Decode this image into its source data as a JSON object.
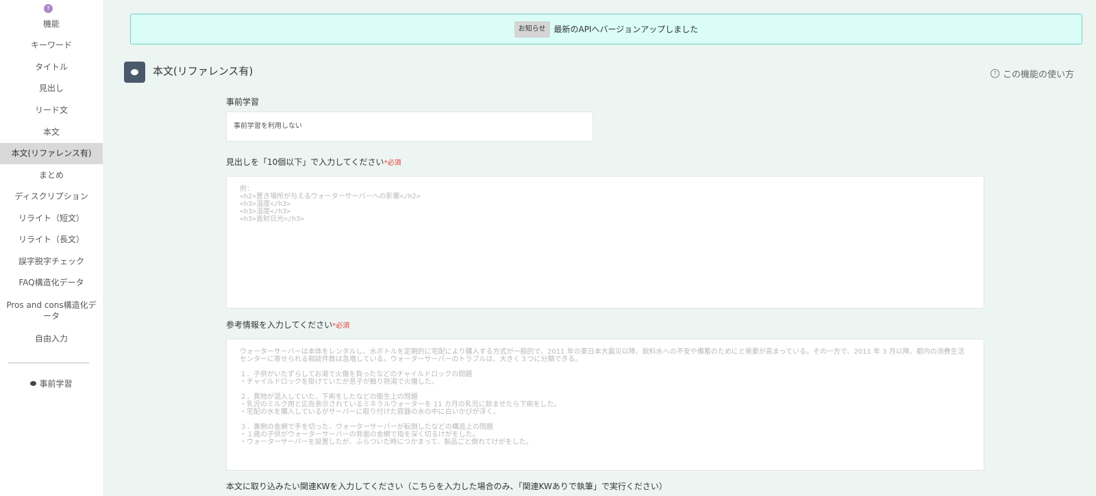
{
  "sidebar": {
    "items": [
      "機能",
      "キーワード",
      "タイトル",
      "見出し",
      "リード文",
      "本文",
      "本文(リファレンス有)",
      "まとめ",
      "ディスクリプション",
      "リライト（短文）",
      "リライト（長文）",
      "誤字脱字チェック",
      "FAQ構造化データ",
      "Pros and cons構造化データ",
      "自由入力"
    ],
    "active_index": 6,
    "pre_learning_label": "事前学習"
  },
  "notice": {
    "badge": "お知らせ",
    "text": "最新のAPIへバージョンアップしました"
  },
  "header": {
    "title": "本文(リファレンス有)",
    "howto": "この機能の使い方"
  },
  "form": {
    "pre_learning": {
      "label": "事前学習",
      "value": "事前学習を利用しない"
    },
    "headings": {
      "label": "見出しを「10個以下」で入力してください",
      "required": "*必須",
      "placeholder": "例：\n<h2>置き場所が与えるウォーターサーバーへの影響</h2>\n<h3>温度</h3>\n<h3>湿度</h3>\n<h3>直射日光</h3>"
    },
    "reference": {
      "label": "参考情報を入力してください",
      "required": "*必須",
      "placeholder": "ウォーターサーバーは本体をレンタルし、水ボトルを定期的に宅配により購入する方式が一般的で、2011 年の東日本大震災以降、飲料水への不安や備蓄のためにと需要が高まっている。その一方で、2011 年 3 月以降、都内の消費生活センターに寄せられる相談件数は急増している。ウォーターサーバーのトラブルは、大きく３つに分類できる。\n\n１．子供がいたずらしてお湯で火傷を負ったなどのチャイルドロックの問題\n・チャイルドロックを掛けていたが息子が触り熱湯で火傷した。\n\n２．異物が混入していた、下痢をしたなどの衛生上の問題\n・乳児のミルク用と広告表示されているミネラルウォーターを 11 カ月の乳児に飲ませたら下痢をした。\n・宅配の水を購入しているがサーバーに取り付けた容器の水の中に白いかびが浮く。\n\n３．裏側の金網で手を切った、ウォーターサーバーが転倒したなどの構造上の問題\n・１歳の子供がウォーターサーバーの背面の金網で指を深く切るけがをした。\n・ウォーターサーバーを設置したが、ふらついた時につかまって、製品ごと倒れてけがをした。"
    },
    "related_kw": {
      "label": "本文に取り込みたい関連KWを入力してください（こちらを入力した場合のみ、「関連KWありで執筆」で実行ください）"
    }
  },
  "colors": {
    "background": "#edf5f3",
    "notice_bg": "#dafdf8",
    "notice_border": "#6fd0c0",
    "required": "#e53935",
    "title_icon": "#4b5a6b"
  }
}
